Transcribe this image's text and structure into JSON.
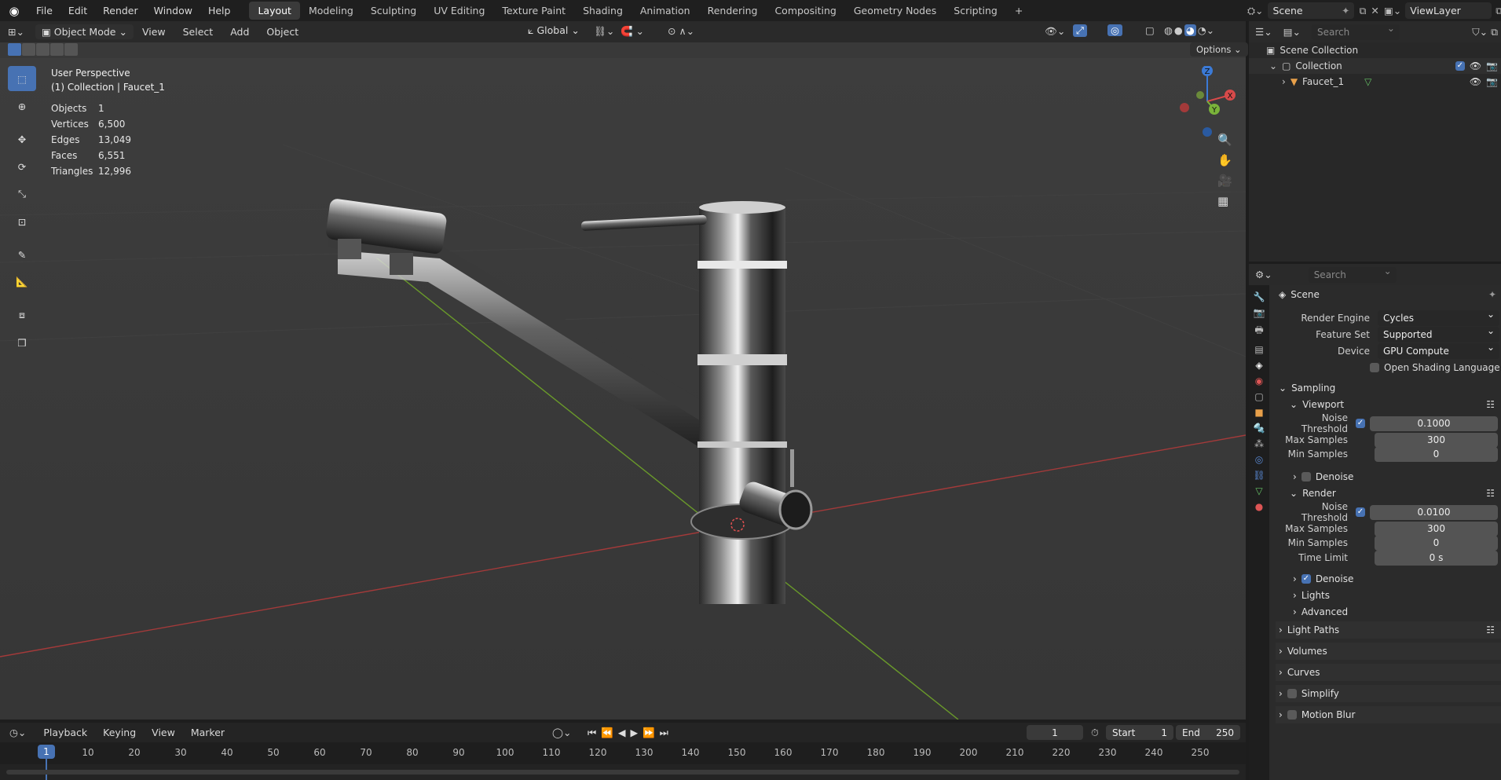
{
  "topbar": {
    "menus": [
      "File",
      "Edit",
      "Render",
      "Window",
      "Help"
    ],
    "workspaces": [
      "Layout",
      "Modeling",
      "Sculpting",
      "UV Editing",
      "Texture Paint",
      "Shading",
      "Animation",
      "Rendering",
      "Compositing",
      "Geometry Nodes",
      "Scripting"
    ],
    "active_workspace": "Layout",
    "add_workspace": "+",
    "scene": "Scene",
    "view_layer": "ViewLayer"
  },
  "viewport_header": {
    "mode": "Object Mode",
    "menus": [
      "View",
      "Select",
      "Add",
      "Object"
    ],
    "transform_orientation": "Global",
    "options": "Options"
  },
  "overlay": {
    "perspective": "User Perspective",
    "collection": "(1) Collection | Faucet_1",
    "stats": [
      {
        "label": "Objects",
        "value": "1"
      },
      {
        "label": "Vertices",
        "value": "6,500"
      },
      {
        "label": "Edges",
        "value": "13,049"
      },
      {
        "label": "Faces",
        "value": "6,551"
      },
      {
        "label": "Triangles",
        "value": "12,996"
      }
    ]
  },
  "gizmo": {
    "x": "X",
    "y": "Y",
    "z": "Z"
  },
  "outliner": {
    "search_placeholder": "Search",
    "scene_collection": "Scene Collection",
    "collection": "Collection",
    "object": "Faucet_1"
  },
  "properties": {
    "search_placeholder": "Search",
    "context": "Scene",
    "render_engine_label": "Render Engine",
    "render_engine": "Cycles",
    "feature_set_label": "Feature Set",
    "feature_set": "Supported",
    "device_label": "Device",
    "device": "GPU Compute",
    "osl_label": "Open Shading Language",
    "sampling": "Sampling",
    "viewport": "Viewport",
    "vp_noise_threshold_label": "Noise Threshold",
    "vp_noise_threshold": "0.1000",
    "vp_max_samples_label": "Max Samples",
    "vp_max_samples": "300",
    "vp_min_samples_label": "Min Samples",
    "vp_min_samples": "0",
    "vp_denoise": "Denoise",
    "render": "Render",
    "r_noise_threshold_label": "Noise Threshold",
    "r_noise_threshold": "0.0100",
    "r_max_samples_label": "Max Samples",
    "r_max_samples": "300",
    "r_min_samples_label": "Min Samples",
    "r_min_samples": "0",
    "r_time_limit_label": "Time Limit",
    "r_time_limit": "0 s",
    "r_denoise": "Denoise",
    "lights": "Lights",
    "advanced": "Advanced",
    "light_paths": "Light Paths",
    "volumes": "Volumes",
    "curves": "Curves",
    "simplify": "Simplify",
    "motion_blur": "Motion Blur"
  },
  "timeline": {
    "menus": [
      "Playback",
      "Keying",
      "View",
      "Marker"
    ],
    "current_frame": "1",
    "start_label": "Start",
    "start": "1",
    "end_label": "End",
    "end": "250",
    "ruler": [
      "1",
      "10",
      "20",
      "30",
      "40",
      "50",
      "60",
      "70",
      "80",
      "90",
      "100",
      "110",
      "120",
      "130",
      "140",
      "150",
      "160",
      "170",
      "180",
      "190",
      "200",
      "210",
      "220",
      "230",
      "240",
      "250"
    ]
  }
}
